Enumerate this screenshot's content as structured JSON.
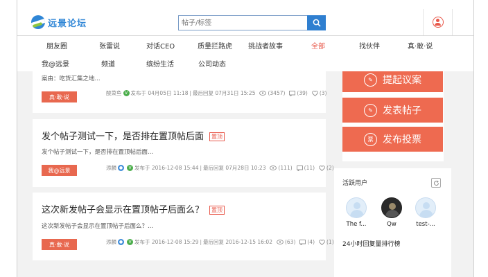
{
  "header": {
    "logo_text": "远景论坛",
    "search_placeholder": "帖子/标签"
  },
  "nav": {
    "items": [
      "朋友圈",
      "张雷说",
      "对话CEO",
      "质量拦路虎",
      "挑战者故事",
      "全部",
      "找伙伴",
      "真·敢·说",
      "我@远景",
      "频道",
      "缤纷生活",
      "公司动态"
    ],
    "active_index": 5
  },
  "posts": [
    {
      "title": "",
      "excerpt": "案由：吃货汇集之地...",
      "tag": "真·敢·说",
      "author": "酸菜鱼",
      "posted": "发布于 04月05日 11:18",
      "last_reply": "最后回复 07月31日 15:25",
      "views": "(3457)",
      "comments": "(39)",
      "likes": "(3)"
    },
    {
      "title": "发个帖子测试一下，是否排在置顶帖后面",
      "badge": "置顶",
      "excerpt": "发个帖子测试一下，是否排在置顶帖后面...",
      "tag": "我@远景",
      "author": "添麟",
      "posted": "发布于 2016-12-08 15:44",
      "last_reply": "最后回复 07月28日 10:23",
      "views": "(111)",
      "comments": "(11)",
      "likes": "(2)"
    },
    {
      "title": "这次新发帖子会显示在置顶帖子后面么？",
      "badge": "置顶",
      "excerpt": "这次新发帖子会显示在置顶帖子后面么？...",
      "tag": "真·敢·说",
      "author": "添麟",
      "posted": "发布于 2016-12-08 15:29",
      "last_reply": "最后回复 2016-12-15 16:02",
      "views": "(63)",
      "comments": "(4)",
      "likes": "(1)"
    }
  ],
  "actions": {
    "propose": "提起议案",
    "post": "发表帖子",
    "vote": "发布投票",
    "vote_icon_text": "票"
  },
  "active_users": {
    "title": "活跃用户",
    "users": [
      "The f...",
      "Qw",
      "test-..."
    ],
    "ranking_title": "24小时回复量排行榜"
  },
  "colors": {
    "accent": "#ee6a50",
    "brand_blue": "#2f86d6",
    "verified_green": "#4cae4c"
  }
}
